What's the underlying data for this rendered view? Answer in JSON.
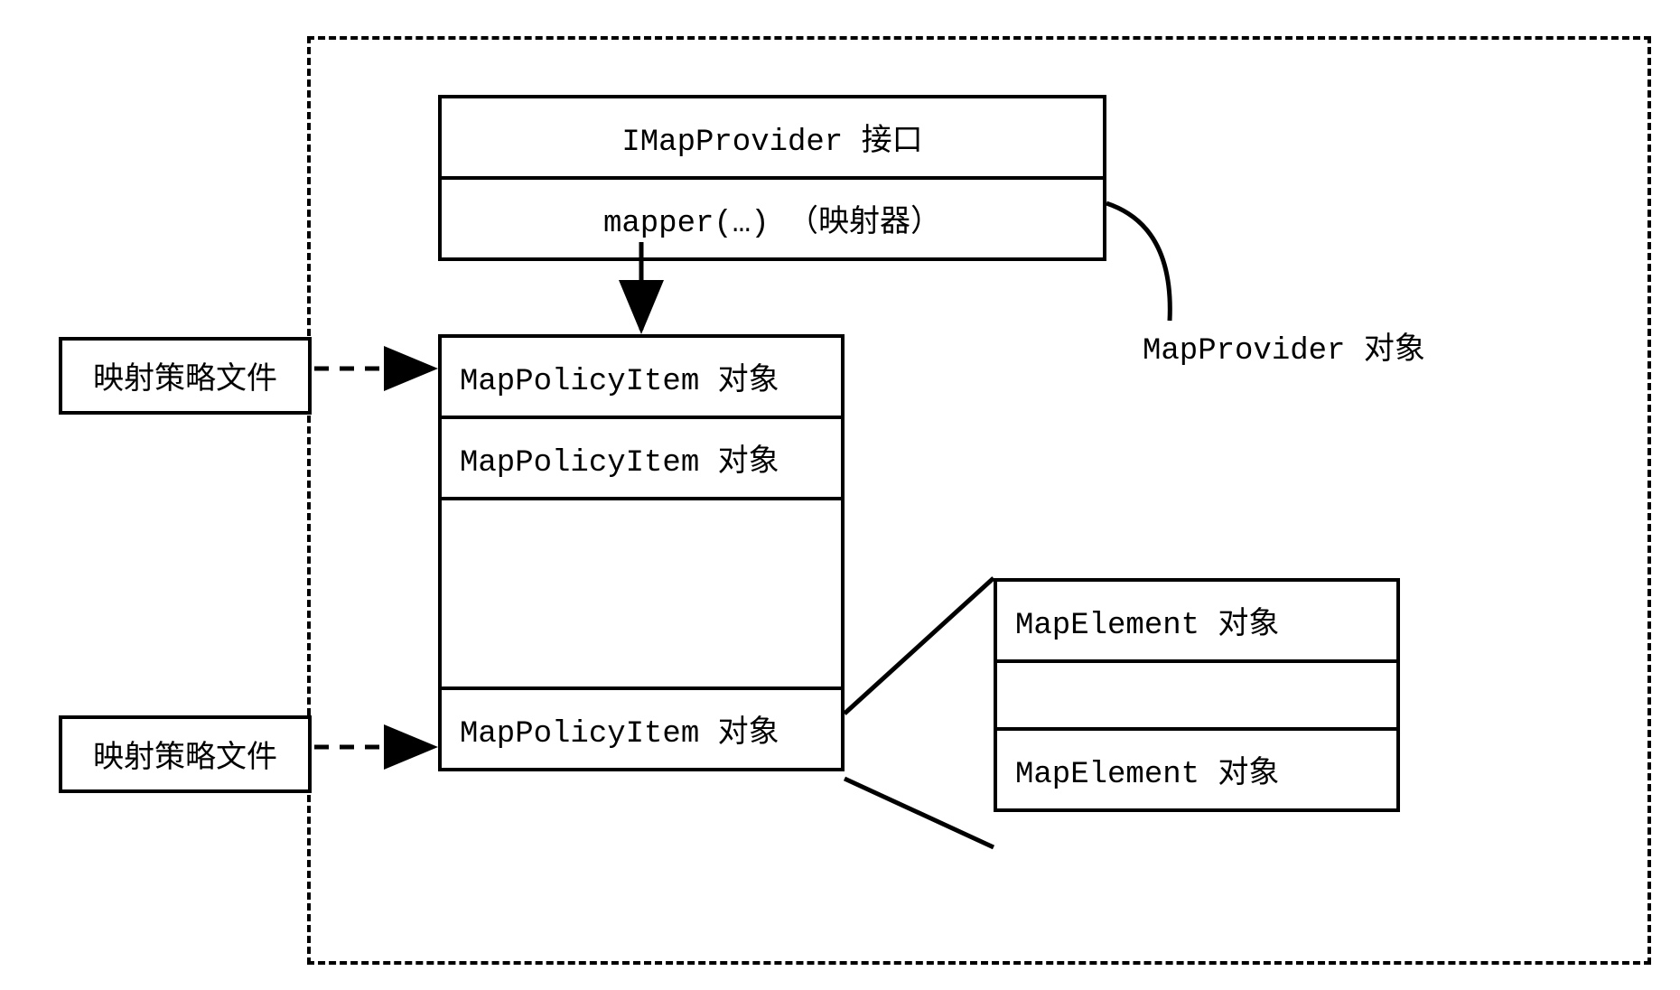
{
  "diagram": {
    "imap_interface": "IMapProvider 接口",
    "mapper": "mapper(…) （映射器）",
    "map_provider_label": "MapProvider 对象",
    "policy_items": {
      "row1": "MapPolicyItem 对象",
      "row2": "MapPolicyItem 对象",
      "row3": "",
      "row4": "MapPolicyItem 对象"
    },
    "map_elements": {
      "row1": "MapElement 对象",
      "row2": "",
      "row3": "MapElement 对象"
    },
    "external_box_1": "映射策略文件",
    "external_box_2": "映射策略文件"
  }
}
